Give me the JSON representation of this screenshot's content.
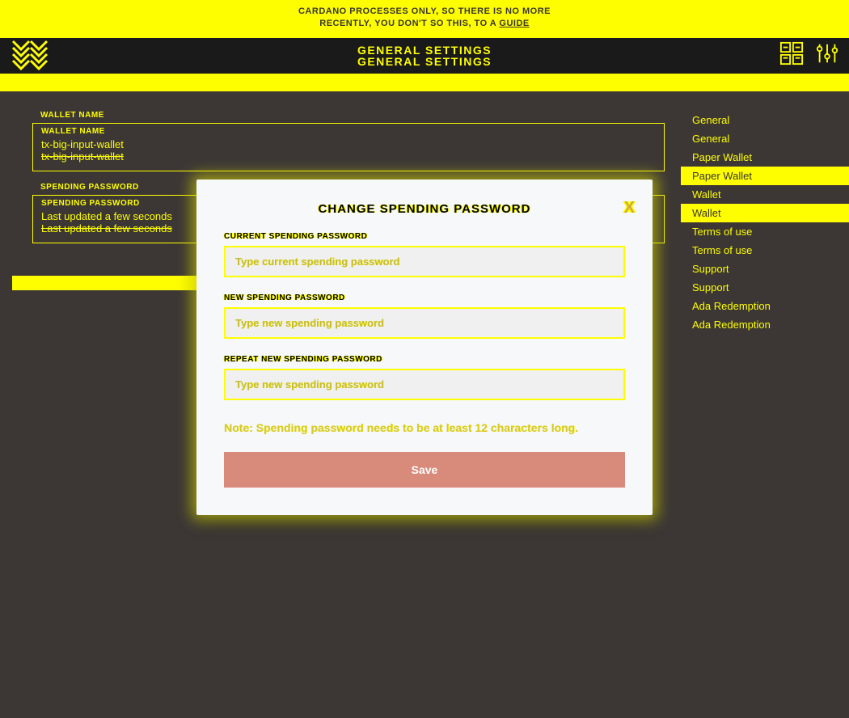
{
  "banner": {
    "line1": "CARDANO PROCESSES ONLY, SO THERE IS NO MORE",
    "line2": "RECENTLY, YOU DON'T SO THIS, TO A ",
    "link": "GUIDE"
  },
  "header": {
    "title": "GENERAL SETTINGS"
  },
  "fields": {
    "walletName": {
      "label": "WALLET NAME",
      "value": "tx-big-input-wallet"
    },
    "spendingPassword": {
      "label": "SPENDING PASSWORD",
      "value": "Last updated a few seconds"
    }
  },
  "sidebar": {
    "items": [
      {
        "label": "General",
        "active": false
      },
      {
        "label": "General",
        "active": false
      },
      {
        "label": "Paper Wallet",
        "active": false
      },
      {
        "label": "Paper Wallet",
        "active": true
      },
      {
        "label": "Wallet",
        "active": false
      },
      {
        "label": "Wallet",
        "active": true
      },
      {
        "label": "Terms of use",
        "active": false
      },
      {
        "label": "Terms of use",
        "active": false
      },
      {
        "label": "Support",
        "active": false
      },
      {
        "label": "Support",
        "active": false
      },
      {
        "label": "Ada Redemption",
        "active": false
      },
      {
        "label": "Ada Redemption",
        "active": false
      }
    ]
  },
  "modal": {
    "title": "CHANGE SPENDING PASSWORD",
    "close": "X",
    "fields": {
      "current": {
        "label": "CURRENT SPENDING PASSWORD",
        "placeholder": "Type current spending password"
      },
      "new": {
        "label": "NEW SPENDING PASSWORD",
        "placeholder": "Type new spending password"
      },
      "repeat": {
        "label": "REPEAT NEW SPENDING PASSWORD",
        "placeholder": "Type new spending password"
      }
    },
    "note": "Note: Spending password needs to be at least 12 characters long.",
    "save": "Save"
  }
}
